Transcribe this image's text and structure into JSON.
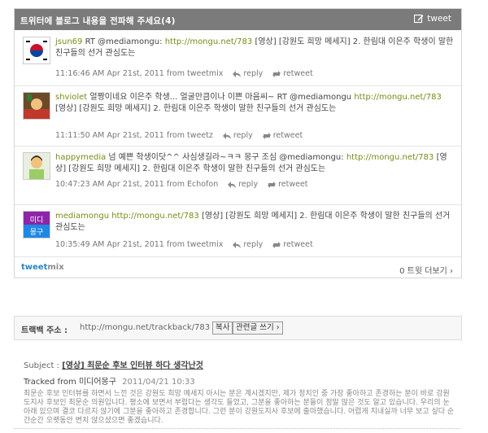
{
  "panel": {
    "title": "트위터에 블로그 내용을 전파해 주세요(4)",
    "tweet_button": "tweet"
  },
  "tweets": [
    {
      "user": "jsun69",
      "text_prefix": "RT @mediamongu:",
      "link": "http://mongu.net/783",
      "text": "[영상] [강원도 희망 메세지] 2. 한림대 이은주 학생이 말한 친구들의 선거 관심도는",
      "time": "11:16:46 AM Apr 21st, 2011 from tweetmix",
      "reply": "reply",
      "retweet": "retweet"
    },
    {
      "user": "shviolet",
      "text_prefix": "얼짱이네요 이은주 학생... 얼굴만큼이나 이쁜 마음씨~ RT @mediamongu",
      "link": "http://mongu.net/783",
      "text": "[영상] [강원도 희망 메세지] 2. 한림대 이은주 학생이 말한 친구들의 선거 관심도는",
      "time": "11:11:50 AM Apr 21st, 2011 from tweetz",
      "reply": "reply",
      "retweet": "retweet"
    },
    {
      "user": "happymedia",
      "text_prefix": "넘 예쁜 학생이닷^^ 사심생길라~ㅋㅋ 몽구 조심 @mediamongu:",
      "link": "http://mongu.net/783",
      "text": "[영상] [강원도 희망 메세지] 2. 한림대 이은주 학생이 말한 친구들의 선거 관심도는",
      "time": "10:47:23 AM Apr 21st, 2011 from Echofon",
      "reply": "reply",
      "retweet": "retweet"
    },
    {
      "user": "mediamongu",
      "text_prefix": "",
      "link": "http://mongu.net/783",
      "text": "[영상] [강원도 희망 메세지] 2. 한림대 이은주 학생이 말한 친구들의 선거 관심도는",
      "time": "10:35:49 AM Apr 21st, 2011 from tweetmix",
      "reply": "reply",
      "retweet": "retweet"
    }
  ],
  "footer": {
    "brand_a": "tweet",
    "brand_b": "mix",
    "more": "0 트윗 더보기 ›"
  },
  "trackback": {
    "label": "트랙백 주소 :",
    "url": "http://mongu.net/trackback/783",
    "copy_button": "복사",
    "write_button": "관련글 쓰기 ›"
  },
  "entry": {
    "subject_label": "Subject :",
    "subject": "[영상] 최문순 후보 인터뷰 하다 생각난것",
    "tracked_from": "Tracked from 미디어몽구",
    "date": "2011/04/21 10:33",
    "excerpt": "최문순 후보 인터뷰를 하면서 느낀 것은 강원도 희망 메세지 아시는 분은 계시겠지만, 제가 정치인 중 가장 좋아하고 존경하는 분이 바로 강원도지사 후보인 최문순 의원입니다. 평소에 보면서 부럽다는 생각도 들었고, 그분을 좋아하는 분들이 정말 많은 것도 알고 있습니다. 우리의 눈 아래 있으며 결코 다르지 않기에 그분을 좋아하고 존경합니다. 그런 분이 강원도지사 후보에 출마했습니다. 어렵게 지내실까 너무 보고 싶다 순간순간 오랫동안 변치 않으셨으면 좋겠습니다."
  }
}
